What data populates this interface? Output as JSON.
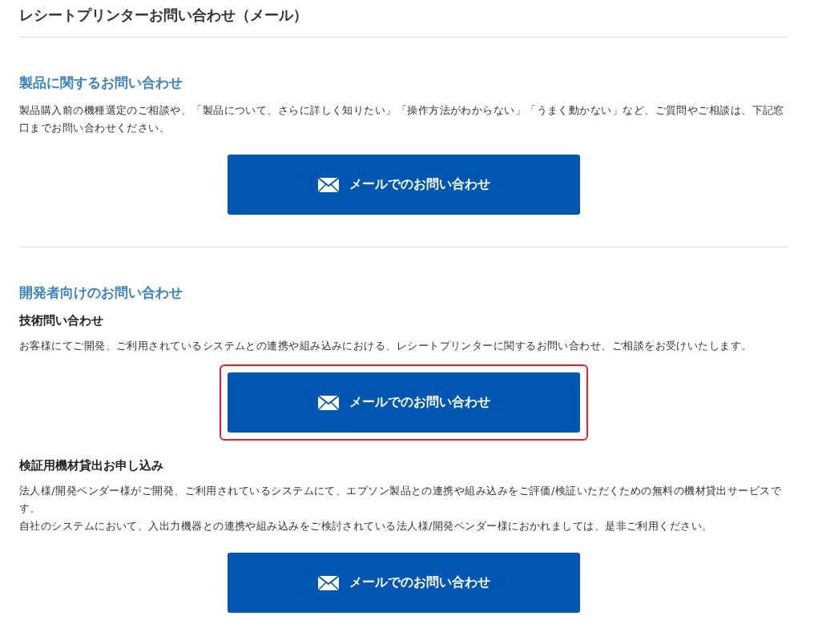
{
  "page_title": "レシートプリンターお問い合わせ（メール）",
  "sections": [
    {
      "heading": "製品に関するお問い合わせ",
      "blocks": [
        {
          "paragraphs": [
            "製品購入前の機種選定のご相談や、「製品について、さらに詳しく知りたい」「操作方法がわからない」「うまく動かない」など、ご質問やご相談は、下記窓口までお問い合わせください。"
          ],
          "button": {
            "label": "メールでのお問い合わせ",
            "focused": false
          }
        }
      ]
    },
    {
      "heading": "開発者向けのお問い合わせ",
      "blocks": [
        {
          "subheading": "技術問い合わせ",
          "paragraphs": [
            "お客様にてご開発、ご利用されているシステムとの連携や組み込みにおける、レシートプリンターに関するお問い合わせ、ご相談をお受けいたします。"
          ],
          "button": {
            "label": "メールでのお問い合わせ",
            "focused": true
          }
        },
        {
          "subheading": "検証用機材貸出お申し込み",
          "paragraphs": [
            "法人様/開発ベンダー様がご開発、ご利用されているシステムにて、エプソン製品との連携や組み込みをご評価/検証いただくための無料の機材貸出サービスです。",
            "自社のシステムにおいて、入出力機器との連携や組み込みをご検討されている法人様/開発ベンダー様におかれましては、是非ご利用ください。"
          ],
          "button": {
            "label": "メールでのお問い合わせ",
            "focused": false
          }
        }
      ]
    }
  ]
}
